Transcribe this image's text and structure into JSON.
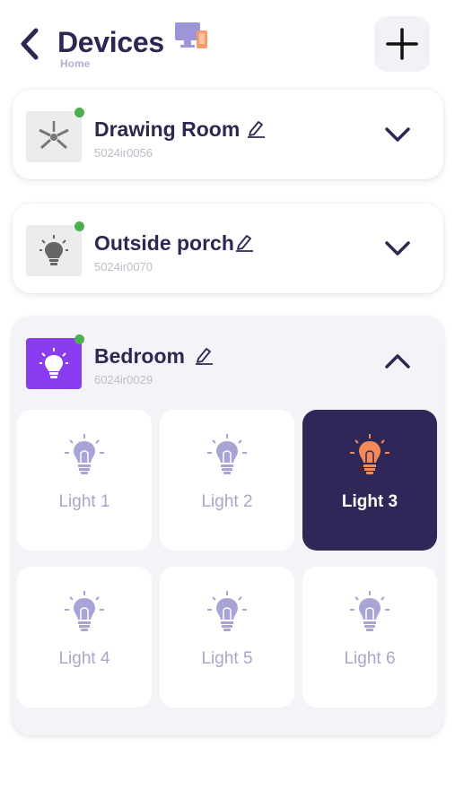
{
  "header": {
    "title": "Devices",
    "subtitle": "Home",
    "back_icon": "chevron-left-icon",
    "devices_icon": "devices-icon",
    "add_icon": "plus-icon"
  },
  "rooms": [
    {
      "name": "Drawing Room",
      "id": "5024ir0056",
      "icon": "fan-icon",
      "online": true,
      "expanded": false
    },
    {
      "name": "Outside porch",
      "id": "5024ir0070",
      "icon": "bulb-icon",
      "online": true,
      "expanded": false
    },
    {
      "name": "Bedroom",
      "id": "6024ir0029",
      "icon": "bulb-icon",
      "online": true,
      "expanded": true
    }
  ],
  "lights": [
    {
      "label": "Light 1",
      "state": "off"
    },
    {
      "label": "Light 2",
      "state": "off"
    },
    {
      "label": "Light 3",
      "state": "on"
    },
    {
      "label": "Light 4",
      "state": "off"
    },
    {
      "label": "Light 5",
      "state": "off"
    },
    {
      "label": "Light 6",
      "state": "off"
    }
  ],
  "colors": {
    "primary_dark": "#2d2852",
    "active_tile": "#2f2757",
    "bulb_off": "#a9a4d6",
    "bulb_on": "#f28a5a",
    "online": "#4caf50",
    "accent_purple": "#8a3cf0"
  }
}
